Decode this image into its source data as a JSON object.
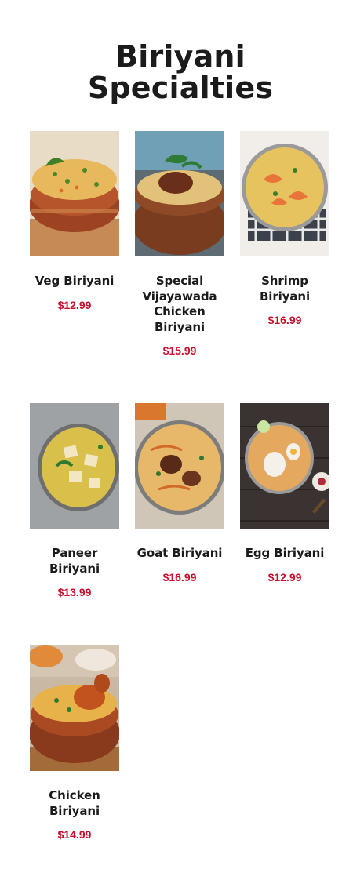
{
  "page": {
    "title_line1": "Biriyani",
    "title_line2": "Specialties"
  },
  "menu": {
    "items": [
      {
        "name": "Veg Biriyani",
        "price": "$12.99",
        "image": "veg-biriyani-photo"
      },
      {
        "name": "Special Vijayawada Chicken Biriyani",
        "price": "$15.99",
        "image": "vijayawada-chicken-biriyani-photo"
      },
      {
        "name": "Shrimp Biriyani",
        "price": "$16.99",
        "image": "shrimp-biriyani-photo"
      },
      {
        "name": "Paneer Biriyani",
        "price": "$13.99",
        "image": "paneer-biriyani-photo"
      },
      {
        "name": "Goat Biriyani",
        "price": "$16.99",
        "image": "goat-biriyani-photo"
      },
      {
        "name": "Egg Biriyani",
        "price": "$12.99",
        "image": "egg-biriyani-photo"
      },
      {
        "name": "Chicken Biriyani",
        "price": "$14.99",
        "image": "chicken-biriyani-photo"
      }
    ]
  },
  "colors": {
    "price": "#c8102e",
    "heading": "#1b1b1b",
    "background": "#ffffff"
  }
}
